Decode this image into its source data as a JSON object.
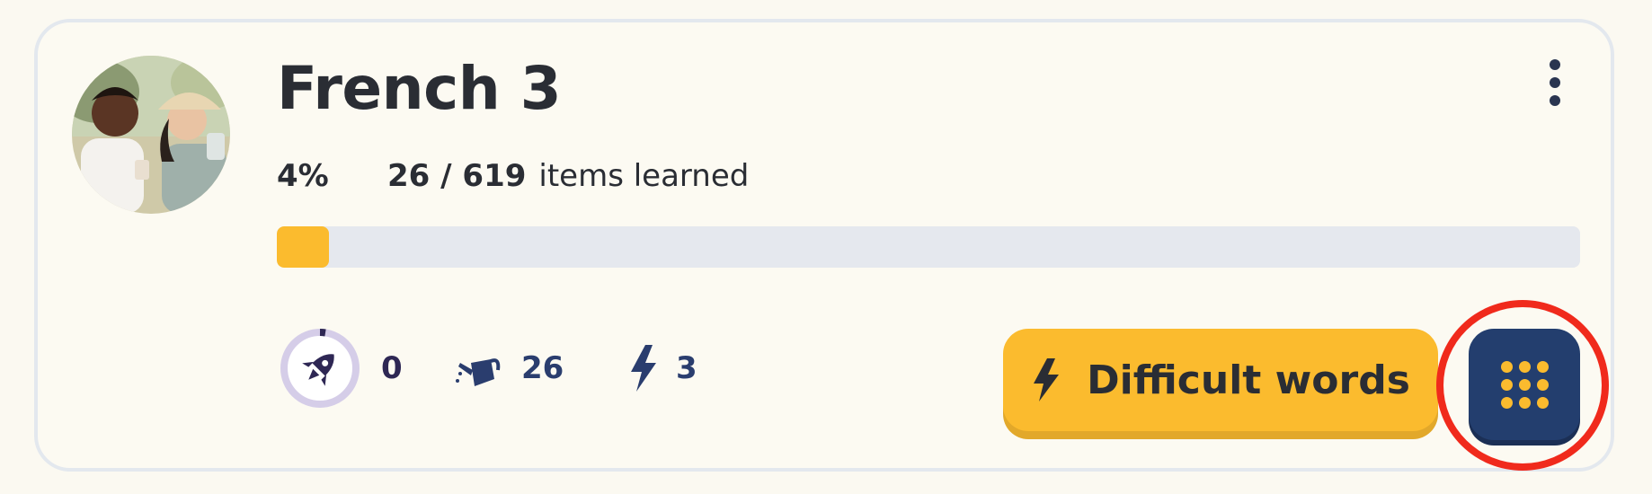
{
  "course": {
    "title": "French 3",
    "percent_label": "4%",
    "items_count": "26 / 619",
    "items_suffix": "items learned",
    "progress": 0.04
  },
  "modes": {
    "learn": {
      "icon": "rocket-icon",
      "value": "0"
    },
    "review": {
      "icon": "watering-can-icon",
      "value": "26"
    },
    "speed_review": {
      "icon": "lightning-icon",
      "value": "3"
    }
  },
  "buttons": {
    "difficult_words": {
      "icon": "lightning-icon",
      "label": "Difficult words"
    },
    "more_modes": {
      "icon": "grid-dots-icon"
    },
    "options": {
      "icon": "kebab-menu-icon"
    }
  },
  "colors": {
    "accent_yellow": "#fbbb2e",
    "navy": "#233e6e",
    "highlight_red": "#f02a1c"
  }
}
